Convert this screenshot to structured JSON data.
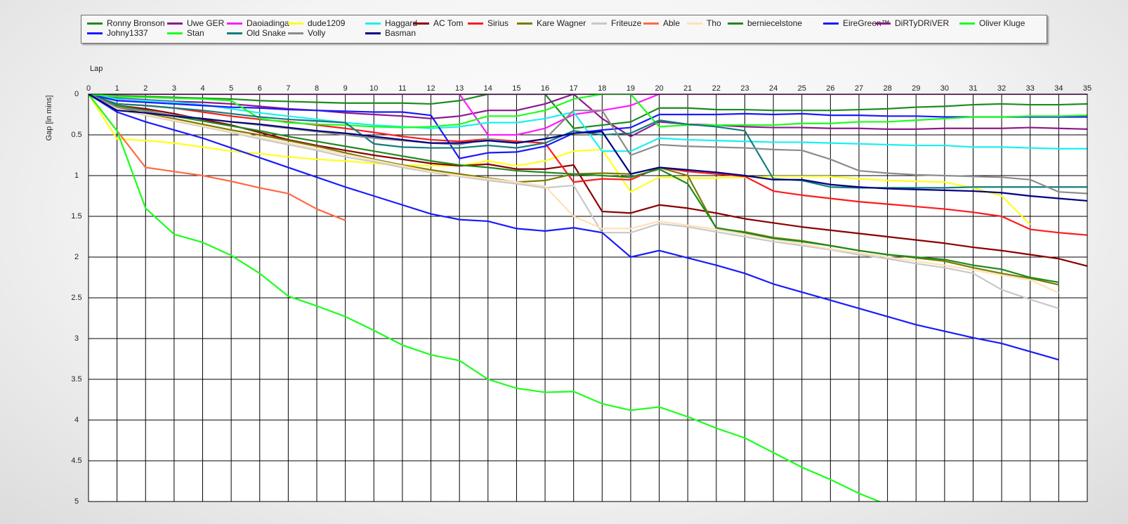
{
  "chart_data": {
    "type": "line",
    "title": "",
    "xlabel": "Lap",
    "ylabel": "Gap [in mins]",
    "xlim": [
      0,
      35
    ],
    "ylim": [
      0,
      5
    ],
    "y_inverted": true,
    "grid": true,
    "legend_position": "top",
    "x_ticks": [
      0,
      1,
      2,
      3,
      4,
      5,
      6,
      7,
      8,
      9,
      10,
      11,
      12,
      13,
      14,
      15,
      16,
      17,
      18,
      19,
      20,
      21,
      22,
      23,
      24,
      25,
      26,
      27,
      28,
      29,
      30,
      31,
      32,
      33,
      34,
      35
    ],
    "y_ticks": [
      0,
      0.5,
      1,
      1.5,
      2,
      2.5,
      3,
      3.5,
      4,
      4.5,
      5
    ],
    "y_tick_labels": [
      "0",
      "0.5",
      "1",
      "1.5",
      "2",
      "2.5",
      "3",
      "3.5",
      "4",
      "4.5",
      "5"
    ],
    "series": [
      {
        "name": "Ronny Bronson",
        "color": "#1f8a1f",
        "values": [
          0,
          0.02,
          0.03,
          0.04,
          0.05,
          0.06,
          0.08,
          0.09,
          0.1,
          0.11,
          0.11,
          0.11,
          0.12,
          0.08,
          0,
          0,
          0,
          0.42,
          0.38,
          0.34,
          0.17,
          0.17,
          0.19,
          0.19,
          0.2,
          0.2,
          0.2,
          0.19,
          0.18,
          0.16,
          0.15,
          0.13,
          0.12,
          0.13,
          0.13,
          0.12
        ]
      },
      {
        "name": "Uwe GER",
        "color": "#8b1a8b",
        "values": [
          0,
          0.05,
          0.07,
          0.09,
          0.1,
          0.12,
          0.15,
          0.18,
          0.2,
          0.23,
          0.25,
          0.27,
          0.3,
          0.27,
          0.2,
          0.2,
          0.12,
          0,
          0.3,
          0.52,
          0.34,
          0.37,
          0.38,
          0.4,
          0.41,
          0.41,
          0.42,
          0.42,
          0.43,
          0.43,
          0.42,
          0.42,
          0.42,
          0.41,
          0.42,
          0.43
        ]
      },
      {
        "name": "Daoiadinga",
        "color": "#ff1aff",
        "values": [
          0,
          0,
          0,
          0,
          0,
          0,
          0,
          0,
          0,
          0,
          0,
          0,
          0,
          0,
          0.5,
          0.5,
          0.42,
          0.25,
          0.2,
          0.14,
          0
        ]
      },
      {
        "name": "dude1209",
        "color": "#ffff1a",
        "values": [
          0,
          0.55,
          0.57,
          0.6,
          0.65,
          0.7,
          0.73,
          0.77,
          0.8,
          0.82,
          0.85,
          0.87,
          0.88,
          0.88,
          0.82,
          0.88,
          0.82,
          0.7,
          0.68,
          1.2,
          1.02,
          1.03,
          1.03,
          1.02,
          1.01,
          1.01,
          1.01,
          1.04,
          1.06,
          1.07,
          1.08,
          1.15,
          1.25,
          1.6
        ]
      },
      {
        "name": "Haggard",
        "color": "#1af0f0",
        "values": [
          0,
          0.06,
          0.08,
          0.1,
          0.13,
          0.18,
          0.23,
          0.27,
          0.31,
          0.35,
          0.38,
          0.4,
          0.42,
          0.4,
          0.35,
          0.35,
          0.3,
          0.22,
          0.7,
          0.7,
          0.54,
          0.56,
          0.57,
          0.58,
          0.59,
          0.59,
          0.6,
          0.61,
          0.62,
          0.63,
          0.63,
          0.65,
          0.65,
          0.66,
          0.67,
          0.67
        ]
      },
      {
        "name": "AC Tom",
        "color": "#8b0000",
        "values": [
          0,
          0.14,
          0.18,
          0.24,
          0.31,
          0.38,
          0.47,
          0.56,
          0.63,
          0.69,
          0.75,
          0.8,
          0.85,
          0.88,
          0.86,
          0.92,
          0.92,
          0.87,
          1.44,
          1.46,
          1.36,
          1.4,
          1.46,
          1.53,
          1.58,
          1.63,
          1.67,
          1.71,
          1.75,
          1.79,
          1.83,
          1.88,
          1.92,
          1.97,
          2.02,
          2.11
        ]
      },
      {
        "name": "Sirius",
        "color": "#ff1a1a",
        "values": [
          0,
          0.12,
          0.14,
          0.17,
          0.22,
          0.27,
          0.31,
          0.34,
          0.38,
          0.42,
          0.47,
          0.52,
          0.56,
          0.58,
          0.55,
          0.58,
          0.6,
          1.08,
          1.04,
          1.05,
          0.9,
          0.95,
          0.98,
          1.01,
          1.19,
          1.24,
          1.28,
          1.32,
          1.35,
          1.38,
          1.41,
          1.45,
          1.5,
          1.66,
          1.7,
          1.73
        ]
      },
      {
        "name": "Kare Wagner",
        "color": "#7a7a00",
        "values": [
          0,
          0.16,
          0.24,
          0.3,
          0.37,
          0.44,
          0.5,
          0.57,
          0.64,
          0.72,
          0.8,
          0.87,
          0.93,
          0.98,
          1.03,
          1.08,
          1.06,
          0.98,
          0.97,
          0.98,
          0.9,
          1.0,
          1.65,
          1.69,
          1.76,
          1.8,
          1.86,
          1.92,
          1.97,
          2.01,
          2.05,
          2.13,
          2.2,
          2.26,
          2.34
        ]
      },
      {
        "name": "Friteuze",
        "color": "#c8c8c8",
        "values": [
          0,
          0.18,
          0.26,
          0.33,
          0.4,
          0.47,
          0.55,
          0.62,
          0.69,
          0.77,
          0.83,
          0.9,
          0.96,
          1.01,
          1.06,
          1.1,
          1.15,
          1.12,
          1.7,
          1.7,
          1.59,
          1.63,
          1.69,
          1.75,
          1.81,
          1.86,
          1.91,
          1.97,
          2.02,
          2.08,
          2.13,
          2.2,
          2.4,
          2.52,
          2.63
        ]
      },
      {
        "name": "Able",
        "color": "#ff6a46",
        "values": [
          0,
          0.45,
          0.9,
          0.95,
          1.0,
          1.07,
          1.15,
          1.22,
          1.41,
          1.55
        ]
      },
      {
        "name": "Tho",
        "color": "#ffe1b4",
        "values": [
          0,
          0.18,
          0.25,
          0.32,
          0.39,
          0.46,
          0.53,
          0.6,
          0.67,
          0.74,
          0.81,
          0.88,
          0.95,
          1.0,
          1.04,
          1.08,
          1.13,
          1.5,
          1.65,
          1.65,
          1.56,
          1.61,
          1.66,
          1.72,
          1.78,
          1.84,
          1.9,
          1.95,
          2.0,
          2.05,
          2.1,
          2.16,
          2.22,
          2.28,
          2.44
        ]
      },
      {
        "name": "berniecelstone",
        "color": "#1f8a1f",
        "values": [
          0,
          0.14,
          0.2,
          0.27,
          0.33,
          0.39,
          0.45,
          0.52,
          0.58,
          0.64,
          0.7,
          0.76,
          0.82,
          0.87,
          0.9,
          0.94,
          0.96,
          0.98,
          1.0,
          1.02,
          0.92,
          1.1,
          1.64,
          1.7,
          1.77,
          1.81,
          1.86,
          1.92,
          1.97,
          2.0,
          2.03,
          2.1,
          2.15,
          2.25,
          2.31
        ]
      },
      {
        "name": "EireGreen™",
        "color": "#1a1aff",
        "values": [
          0,
          0.08,
          0.1,
          0.12,
          0.14,
          0.16,
          0.17,
          0.19,
          0.2,
          0.21,
          0.22,
          0.22,
          0.26,
          0.79,
          0.72,
          0.71,
          0.64,
          0.48,
          0.44,
          0.41,
          0.25,
          0.25,
          0.25,
          0.24,
          0.25,
          0.24,
          0.26,
          0.26,
          0.27,
          0.27,
          0.28,
          0.28,
          0.28,
          0.28,
          0.28,
          0.28
        ]
      },
      {
        "name": "DiRTyDRiVER",
        "color": "#8b1a8b",
        "values": [
          0,
          0,
          0,
          0,
          0,
          0,
          0,
          0,
          0,
          0,
          0,
          0,
          0,
          0,
          0,
          0,
          0,
          0,
          0,
          0,
          0,
          0,
          0,
          0,
          0,
          0,
          0,
          0,
          0,
          0,
          0,
          0,
          0,
          0,
          0,
          0
        ]
      },
      {
        "name": "Oliver Kluge",
        "color": "#1aff1a",
        "values": [
          0,
          0.03,
          0.04,
          0.05,
          0.06,
          0.08,
          0.3,
          0.35,
          0.37,
          0.38,
          0.4,
          0.41,
          0.4,
          0.37,
          0.27,
          0.27,
          0.2,
          0.06,
          0,
          0,
          0.4,
          0.38,
          0.38,
          0.38,
          0.38,
          0.36,
          0.36,
          0.34,
          0.34,
          0.32,
          0.3,
          0.28,
          0.28,
          0.27,
          0.27,
          0.26
        ]
      },
      {
        "name": "Johny1337",
        "color": "#1a1aff",
        "values": [
          0,
          0.22,
          0.34,
          0.44,
          0.54,
          0.66,
          0.78,
          0.9,
          1.02,
          1.14,
          1.25,
          1.36,
          1.47,
          1.54,
          1.56,
          1.65,
          1.68,
          1.64,
          1.7,
          2.0,
          1.92,
          2.01,
          2.1,
          2.2,
          2.33,
          2.43,
          2.53,
          2.63,
          2.73,
          2.83,
          2.91,
          2.99,
          3.06,
          3.16,
          3.26
        ]
      },
      {
        "name": "Stan",
        "color": "#1aff1a",
        "values": [
          0,
          0.45,
          1.4,
          1.72,
          1.82,
          1.98,
          2.2,
          2.48,
          2.6,
          2.73,
          2.9,
          3.08,
          3.2,
          3.27,
          3.5,
          3.61,
          3.66,
          3.65,
          3.8,
          3.88,
          3.84,
          3.96,
          4.1,
          4.22,
          4.4,
          4.58,
          4.73,
          4.9,
          5.04
        ]
      },
      {
        "name": "Old Snake",
        "color": "#147d7d",
        "values": [
          0,
          0.12,
          0.14,
          0.17,
          0.2,
          0.24,
          0.28,
          0.31,
          0.33,
          0.35,
          0.61,
          0.65,
          0.66,
          0.66,
          0.63,
          0.66,
          0.6,
          0.45,
          0.5,
          0.48,
          0.32,
          0.37,
          0.4,
          0.45,
          1.04,
          1.06,
          1.14,
          1.15,
          1.15,
          1.15,
          1.15,
          1.14,
          1.14,
          1.14,
          1.14,
          1.14
        ]
      },
      {
        "name": "Volly",
        "color": "#8c8c8c",
        "values": [
          0,
          0.16,
          0.21,
          0.26,
          0.3,
          0.34,
          0.38,
          0.42,
          0.46,
          0.5,
          0.54,
          0.57,
          0.6,
          0.62,
          0.55,
          0.6,
          0.55,
          0.2,
          0.2,
          0.75,
          0.62,
          0.64,
          0.65,
          0.66,
          0.68,
          0.69,
          0.8,
          0.94,
          0.97,
          0.99,
          1.0,
          1.01,
          1.02,
          1.05,
          1.2,
          1.22
        ]
      },
      {
        "name": "Basman",
        "color": "#000080",
        "values": [
          0,
          0.2,
          0.23,
          0.27,
          0.3,
          0.34,
          0.37,
          0.41,
          0.45,
          0.48,
          0.52,
          0.56,
          0.6,
          0.6,
          0.57,
          0.6,
          0.55,
          0.48,
          0.46,
          0.98,
          0.9,
          0.93,
          0.96,
          1.0,
          1.05,
          1.05,
          1.11,
          1.14,
          1.16,
          1.17,
          1.18,
          1.19,
          1.21,
          1.25,
          1.28,
          1.31
        ]
      }
    ]
  }
}
